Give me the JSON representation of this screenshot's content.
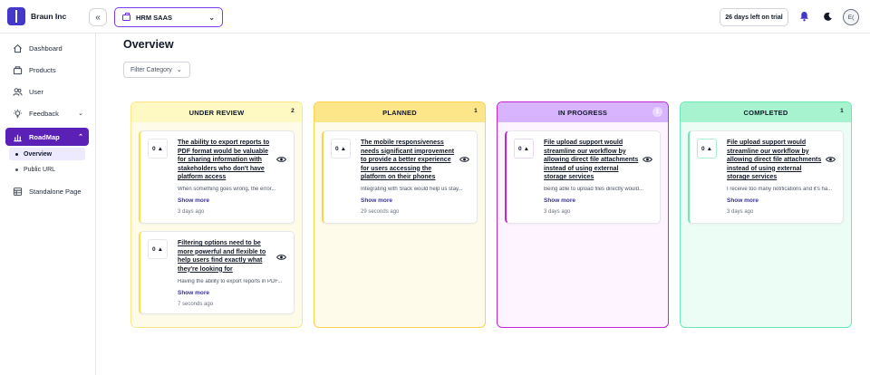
{
  "app": {
    "org_name": "Braun Inc",
    "workspace": "HRM SAAS",
    "trial": "26 days left on trial",
    "avatar_initials": "E("
  },
  "sidebar": {
    "items": [
      {
        "label": "Dashboard",
        "icon": "home-icon"
      },
      {
        "label": "Products",
        "icon": "box-icon"
      },
      {
        "label": "User",
        "icon": "users-icon"
      },
      {
        "label": "Feedback",
        "icon": "lightbulb-icon"
      },
      {
        "label": "RoadMap",
        "icon": "chart-icon"
      },
      {
        "label": "Standalone Page",
        "icon": "table-icon"
      }
    ],
    "roadmap_sub": [
      {
        "label": "Overview"
      },
      {
        "label": "Public URL"
      }
    ]
  },
  "main": {
    "title": "Overview",
    "filter_placeholder": "Filter Category"
  },
  "columns": [
    {
      "title": "UNDER REVIEW",
      "count": "2",
      "accent": "#fde047",
      "head_bg": "#fef9c3",
      "cards": [
        {
          "votes": "0",
          "title": "The ability to export reports to PDF format would be valuable for sharing information with stakeholders who don't have platform access",
          "desc": "When something goes wrong, the error...",
          "more": "Show more",
          "time": "3 days ago"
        },
        {
          "votes": "0",
          "title": "Filtering options need to be more powerful and flexible to help users find exactly what they're looking for",
          "desc": "Having the ability to export reports in PDF...",
          "more": "Show more",
          "time": "7 seconds ago"
        }
      ]
    },
    {
      "title": "PLANNED",
      "count": "1",
      "accent": "#fcd34d",
      "head_bg": "#fde68a",
      "cards": [
        {
          "votes": "0",
          "title": "The mobile responsiveness needs significant improvement to provide a better experience for users accessing the platform on their phones",
          "desc": "Integrating with Slack would help us stay...",
          "more": "Show more",
          "time": "29 seconds ago"
        }
      ]
    },
    {
      "title": "IN PROGRESS",
      "count": "1",
      "accent": "#c026d3",
      "head_bg": "#d8b4fe",
      "cards": [
        {
          "votes": "0",
          "title": "File upload support would streamline our workflow by allowing direct file attachments instead of using external storage services",
          "desc": "Being able to upload files directly would...",
          "more": "Show more",
          "time": "3 days ago"
        }
      ]
    },
    {
      "title": "COMPLETED",
      "count": "1",
      "accent": "#6ee7b7",
      "head_bg": "#a7f3d0",
      "cards": [
        {
          "votes": "0",
          "title": "File upload support would streamline our workflow by allowing direct file attachments instead of using external storage services",
          "desc": "I receive too many notifications and it's ha...",
          "more": "Show more",
          "time": "3 days ago"
        }
      ]
    }
  ]
}
